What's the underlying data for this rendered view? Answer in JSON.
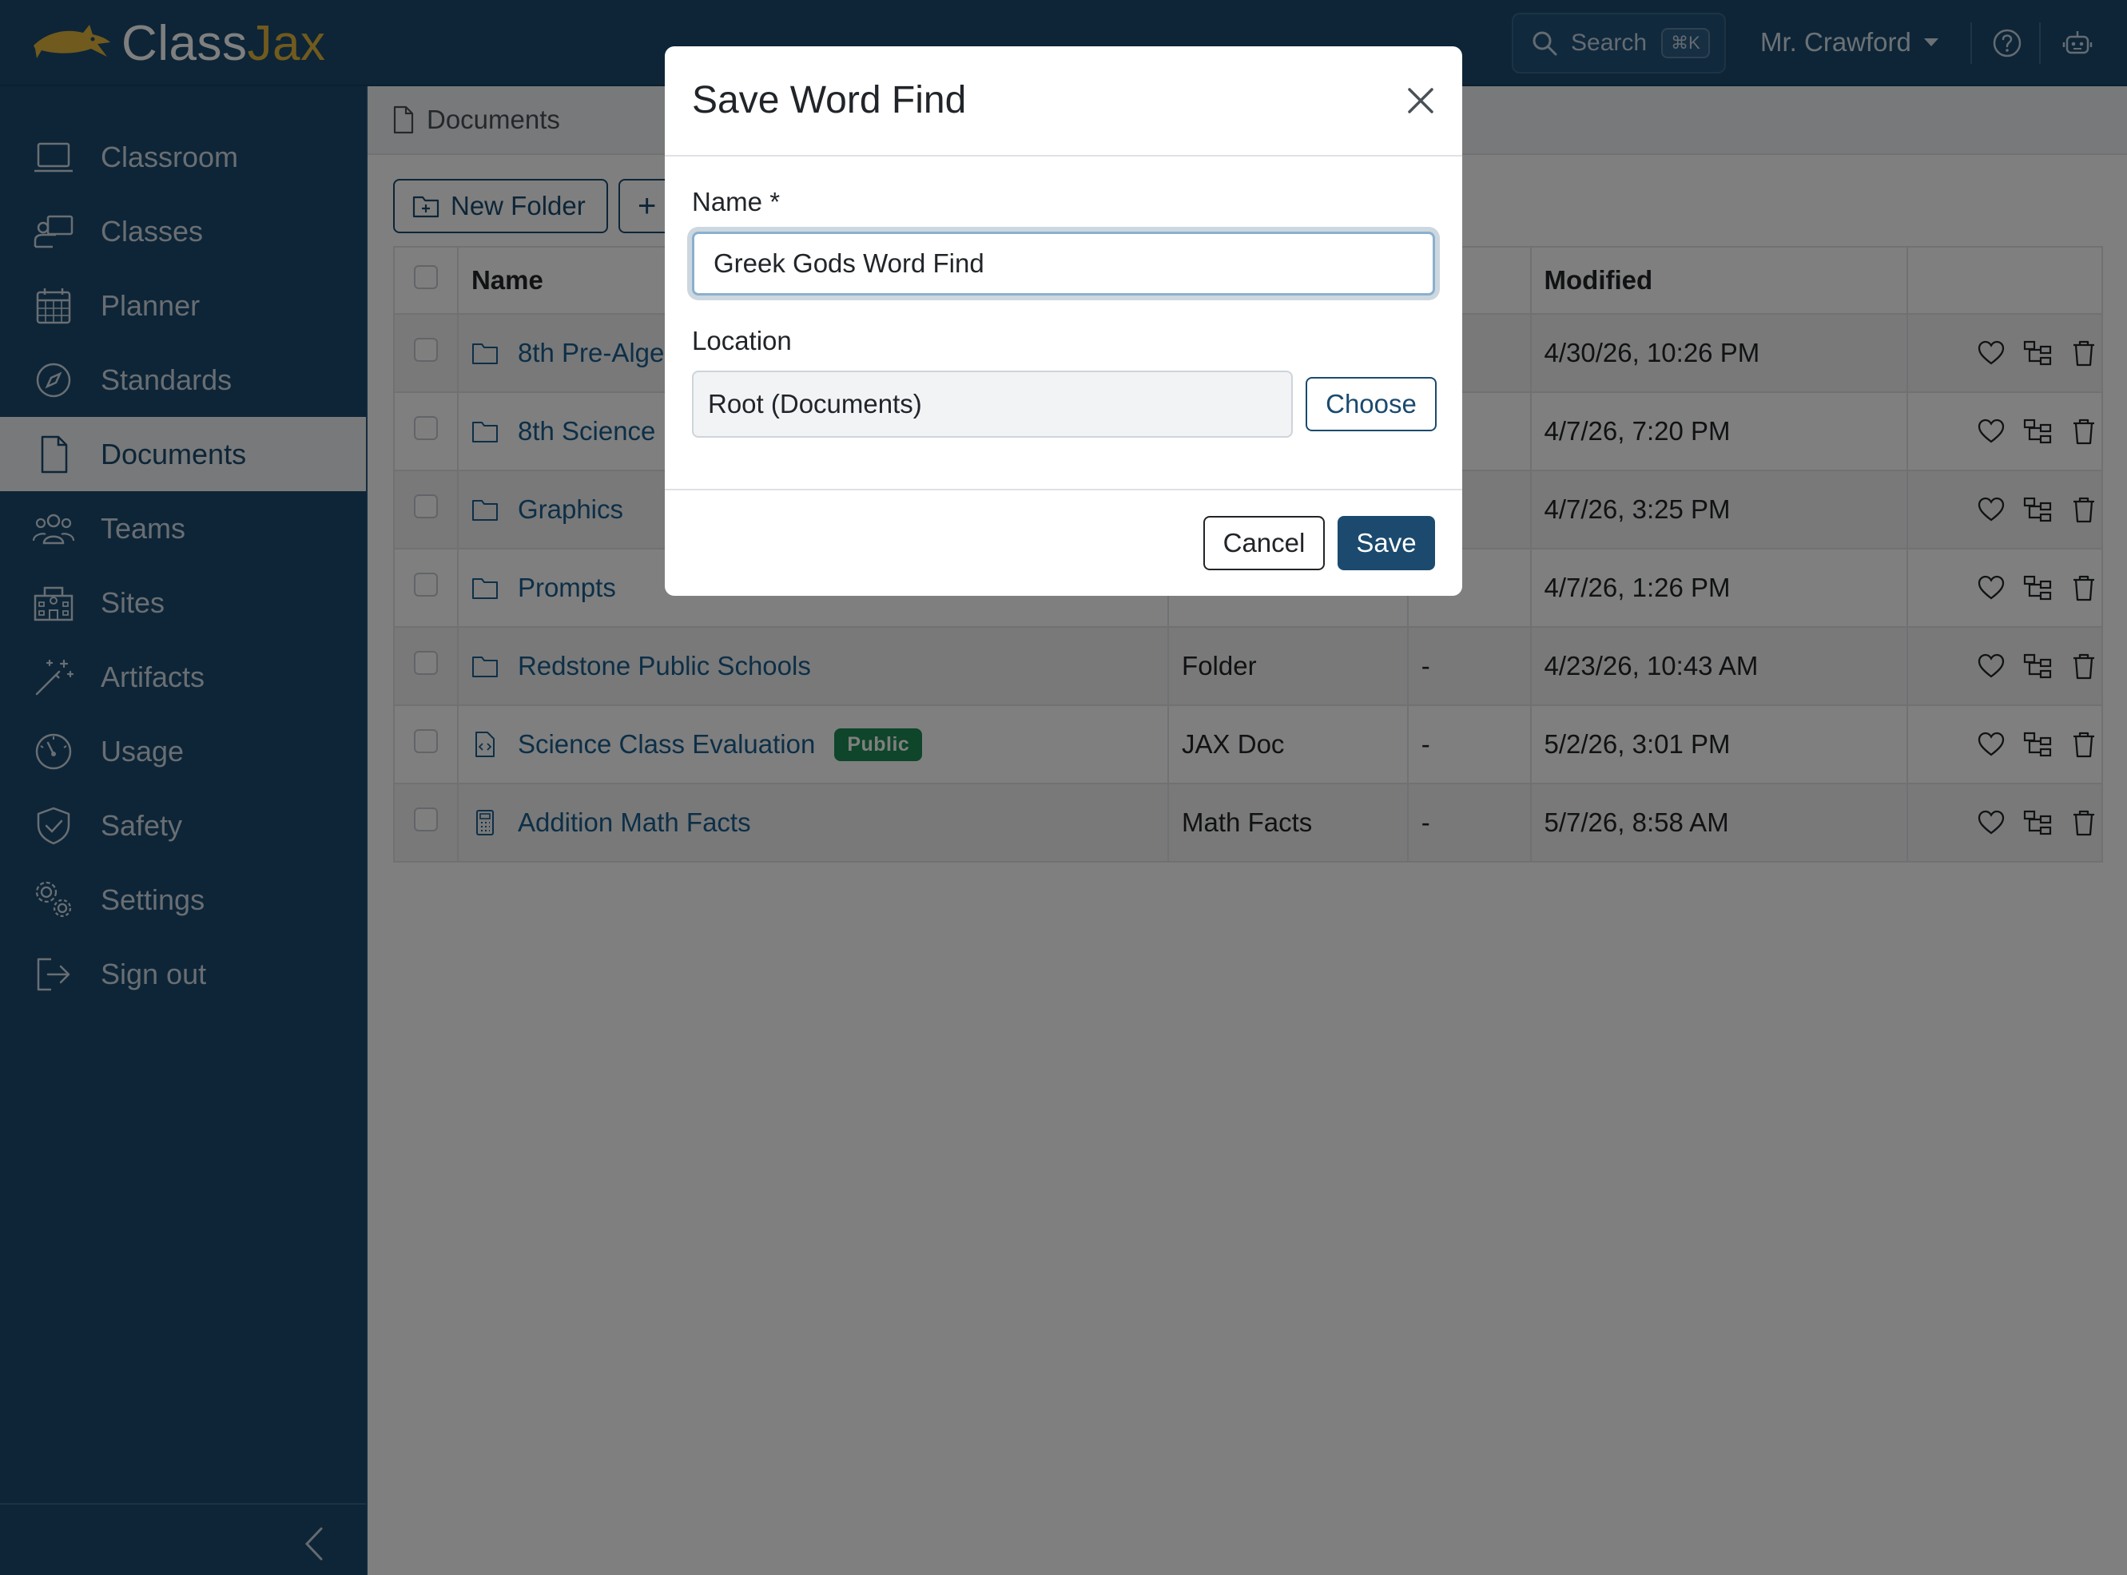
{
  "app": {
    "logo_part1": "Class",
    "logo_part2": "Jax",
    "search_label": "Search",
    "search_shortcut": "⌘K",
    "user_name": "Mr. Crawford"
  },
  "sidebar": {
    "items": [
      {
        "label": "Classroom",
        "icon": "laptop-icon"
      },
      {
        "label": "Classes",
        "icon": "teacher-board-icon"
      },
      {
        "label": "Planner",
        "icon": "calendar-icon"
      },
      {
        "label": "Standards",
        "icon": "compass-icon"
      },
      {
        "label": "Documents",
        "icon": "document-icon",
        "active": true
      },
      {
        "label": "Teams",
        "icon": "people-icon"
      },
      {
        "label": "Sites",
        "icon": "building-icon"
      },
      {
        "label": "Artifacts",
        "icon": "magic-wand-icon"
      },
      {
        "label": "Usage",
        "icon": "speedometer-icon"
      },
      {
        "label": "Safety",
        "icon": "shield-check-icon"
      },
      {
        "label": "Settings",
        "icon": "gears-icon"
      },
      {
        "label": "Sign out",
        "icon": "sign-out-icon"
      }
    ]
  },
  "breadcrumb": {
    "label": "Documents"
  },
  "toolbar": {
    "new_folder_label": "New Folder",
    "new_label": "+"
  },
  "table": {
    "headers": {
      "name": "Name",
      "type": "",
      "size": "e",
      "modified": "Modified"
    },
    "rows": [
      {
        "name": "8th Pre-Alge",
        "type": "",
        "size": "",
        "modified": "4/30/26, 10:26 PM",
        "icon": "folder-icon"
      },
      {
        "name": "8th Science",
        "type": "",
        "size": "",
        "modified": "4/7/26, 7:20 PM",
        "icon": "folder-icon"
      },
      {
        "name": "Graphics",
        "type": "",
        "size": "",
        "modified": "4/7/26, 3:25 PM",
        "icon": "folder-icon"
      },
      {
        "name": "Prompts",
        "type": "",
        "size": "",
        "modified": "4/7/26, 1:26 PM",
        "icon": "folder-icon"
      },
      {
        "name": "Redstone Public Schools",
        "type": "Folder",
        "size": "-",
        "modified": "4/23/26, 10:43 AM",
        "icon": "folder-icon"
      },
      {
        "name": "Science Class Evaluation",
        "badge": "Public",
        "type": "JAX Doc",
        "size": "-",
        "modified": "5/2/26, 3:01 PM",
        "icon": "code-file-icon"
      },
      {
        "name": "Addition Math Facts",
        "type": "Math Facts",
        "size": "-",
        "modified": "5/7/26, 8:58 AM",
        "icon": "calculator-icon"
      }
    ]
  },
  "modal": {
    "title": "Save Word Find",
    "name_label": "Name *",
    "name_value": "Greek Gods Word Find",
    "location_label": "Location",
    "location_value": "Root (Documents)",
    "choose_label": "Choose",
    "cancel_label": "Cancel",
    "save_label": "Save"
  },
  "colors": {
    "brand_navy": "#1b4a6e",
    "brand_gold": "#e2b43c",
    "public_badge": "#1f8a55"
  }
}
